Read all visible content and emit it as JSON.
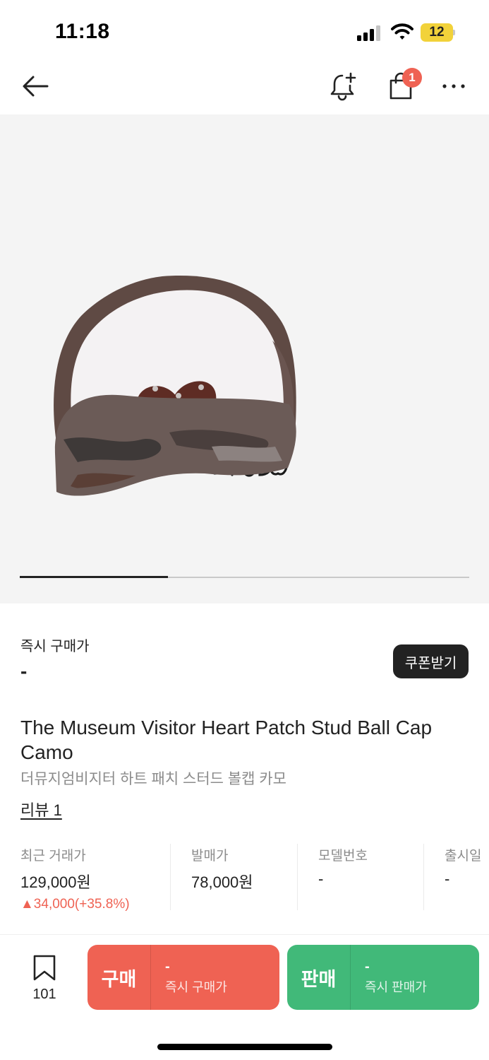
{
  "status_bar": {
    "time": "11:18",
    "battery_level": "12",
    "battery_color": "#f2d23a",
    "icons": [
      "signal-icon",
      "wifi-icon",
      "battery-icon"
    ]
  },
  "nav": {
    "icons": [
      "back-arrow-icon",
      "bell-plus-icon",
      "shopping-bag-icon",
      "more-dots-icon"
    ],
    "cart_badge": "1"
  },
  "gallery": {
    "image": "cap-camo-heart-patch",
    "progress_fraction": 0.33
  },
  "price": {
    "label": "즉시 구매가",
    "value": "-",
    "coupon_label": "쿠폰받기"
  },
  "product": {
    "title": "The Museum Visitor Heart Patch Stud Ball Cap Camo",
    "subtitle": "더뮤지엄비지터 하트 패치 스터드 볼캡 카모",
    "review": "리뷰 1"
  },
  "info": {
    "recent_label": "최근 거래가",
    "recent_value": "129,000원",
    "recent_change": "▲34,000(+35.8%)",
    "release_price_label": "발매가",
    "release_price_value": "78,000원",
    "model_label": "모델번호",
    "model_value": "-",
    "release_date_label": "출시일",
    "release_date_value": "-"
  },
  "bottom": {
    "wish_count": "101",
    "buy_label": "구매",
    "buy_price": "-",
    "buy_caption": "즉시 구매가",
    "sell_label": "판매",
    "sell_price": "-",
    "sell_caption": "즉시 판매가"
  },
  "colors": {
    "buy": "#ef6253",
    "sell": "#41b979",
    "badge": "#ef6253",
    "price_up": "#ef6253"
  }
}
